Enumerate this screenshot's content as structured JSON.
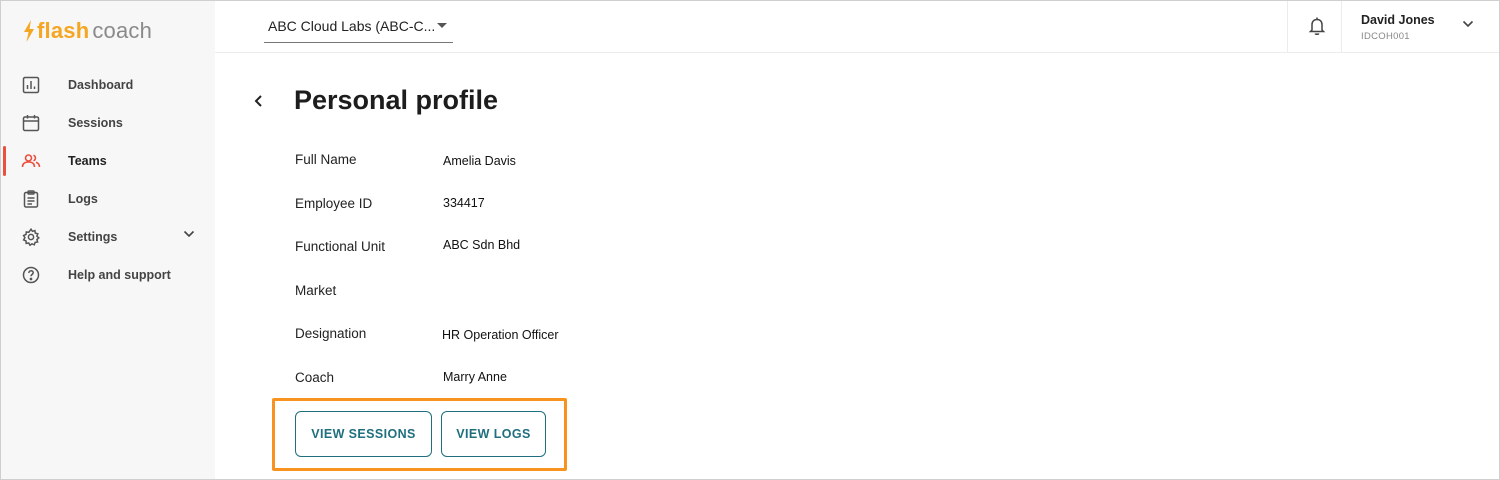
{
  "brand": {
    "word1": "flash",
    "word2": "coach",
    "accent": "#f5a623"
  },
  "sidebar": {
    "items": [
      {
        "label": "Dashboard",
        "icon": "chart-icon"
      },
      {
        "label": "Sessions",
        "icon": "calendar-icon"
      },
      {
        "label": "Teams",
        "icon": "people-icon",
        "active": true
      },
      {
        "label": "Logs",
        "icon": "clipboard-icon"
      },
      {
        "label": "Settings",
        "icon": "gear-icon",
        "expandable": true
      },
      {
        "label": "Help and support",
        "icon": "help-icon"
      }
    ],
    "active_color": "#e9503e"
  },
  "header": {
    "org_select": "ABC Cloud Labs (ABC-C...",
    "user": {
      "name": "David Jones",
      "id": "IDCOH001"
    }
  },
  "profile": {
    "title": "Personal profile",
    "fields": [
      {
        "label": "Full Name",
        "value": "Amelia Davis"
      },
      {
        "label": "Employee ID",
        "value": "334417"
      },
      {
        "label": "Functional Unit",
        "value": "ABC Sdn Bhd"
      },
      {
        "label": "Market",
        "value": ""
      },
      {
        "label": "Designation",
        "value": "HR Operation Officer"
      },
      {
        "label": "Coach",
        "value": "Marry Anne"
      }
    ]
  },
  "actions": {
    "view_sessions": "VIEW SESSIONS",
    "view_logs": "VIEW LOGS",
    "button_color": "#1f6f7e",
    "highlight_color": "#f7931e"
  }
}
